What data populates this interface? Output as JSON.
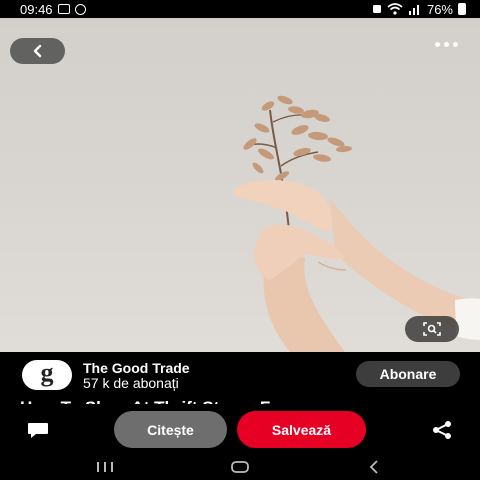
{
  "status_bar": {
    "time": "09:46",
    "battery": "76%",
    "icons": [
      "gallery-icon",
      "whatsapp-icon",
      "screenshot-icon",
      "wifi-icon",
      "signal-icon",
      "battery-icon"
    ]
  },
  "hero": {
    "description": "",
    "buttons": [
      "back-icon",
      "more-options-icon",
      "visual-search-icon"
    ]
  },
  "publisher": {
    "avatar_letter": "g",
    "name": "The Good Trade",
    "followers": "57 k de abonați",
    "subscribe_label": "Abonare"
  },
  "pin": {
    "title": "How To Shop At Thrift Stores For"
  },
  "actions": {
    "read_label": "Citește",
    "save_label": "Salvează",
    "save_color": "#e60023"
  },
  "nav": {
    "items": [
      "recents-icon",
      "home-icon",
      "back-icon"
    ]
  }
}
